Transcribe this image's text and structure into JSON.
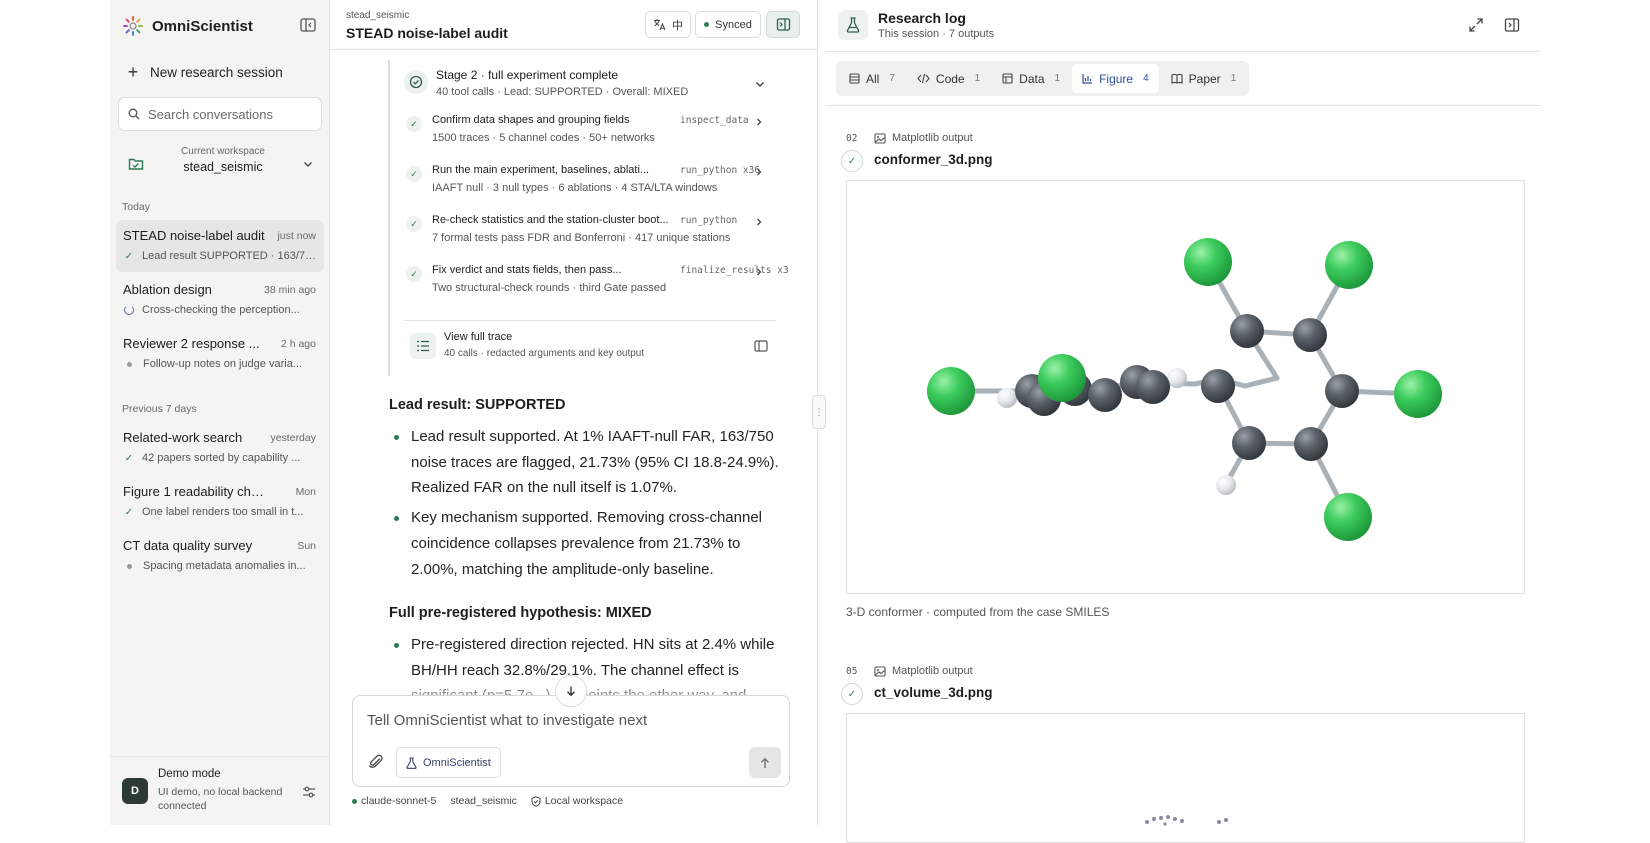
{
  "sidebar": {
    "brand": "OmniScientist",
    "new_session": "New research session",
    "search_placeholder": "Search conversations",
    "workspace": {
      "label": "Current workspace",
      "name": "stead_seismic"
    },
    "groups": [
      {
        "label": "Today",
        "items": [
          {
            "title": "STEAD noise-label audit",
            "time": "just now",
            "sub": "Lead result SUPPORTED · 163/750",
            "status": "done",
            "active": true
          },
          {
            "title": "Ablation design",
            "time": "38 min ago",
            "sub": "Cross-checking the perception...",
            "status": "running"
          },
          {
            "title": "Reviewer 2 response ...",
            "time": "2 h ago",
            "sub": "Follow-up notes on judge varia...",
            "status": "idle"
          }
        ]
      },
      {
        "label": "Previous 7 days",
        "items": [
          {
            "title": "Related-work search",
            "time": "yesterday",
            "sub": "42 papers sorted by capability ...",
            "status": "done"
          },
          {
            "title": "Figure 1 readability check",
            "time": "Mon",
            "sub": "One label renders too small in t...",
            "status": "done"
          },
          {
            "title": "CT data quality survey",
            "time": "Sun",
            "sub": "Spacing metadata anomalies in...",
            "status": "idle"
          }
        ]
      }
    ],
    "demo": {
      "avatar": "D",
      "title": "Demo mode",
      "desc": "UI demo, no local backend connected"
    }
  },
  "chat": {
    "crumb": "stead_seismic",
    "title": "STEAD noise-label audit",
    "lang_label": "中",
    "sync_label": "Synced",
    "stage": {
      "title": "Stage 2 · full experiment complete",
      "sub": "40 tool calls · Lead: SUPPORTED · Overall: MIXED",
      "steps": [
        {
          "title": "Confirm data shapes and grouping fields",
          "tool": "inspect_data",
          "sub": "1500 traces · 5 channel codes · 50+ networks"
        },
        {
          "title": "Run the main experiment, baselines, ablati...",
          "tool": "run_python x36",
          "sub": "IAAFT null · 3 null types · 6 ablations · 4 STA/LTA windows"
        },
        {
          "title": "Re-check statistics and the station-cluster boot...",
          "tool": "run_python",
          "sub": "7 formal tests pass FDR and Bonferroni · 417 unique stations"
        },
        {
          "title": "Fix verdict and stats fields, then pass...",
          "tool": "finalize_results x3",
          "sub": "Two structural-check rounds · third Gate passed"
        }
      ],
      "trace": {
        "title": "View full trace",
        "sub": "40 calls · redacted arguments and key output"
      }
    },
    "lead_heading": "Lead result: SUPPORTED",
    "lead_bullets": [
      "Lead result supported. At 1% IAAFT-null FAR, 163/750 noise traces are flagged, 21.73% (95% CI 18.8-24.9%). Realized FAR on the null itself is 1.07%.",
      "Key mechanism supported. Removing cross-channel coincidence collapses prevalence from 21.73% to 2.00%, matching the amplitude-only baseline."
    ],
    "full_heading": "Full pre-registered hypothesis: MIXED",
    "full_bullets": [
      "Pre-registered direction rejected. HN sits at 2.4% while BH/HH reach 32.8%/29.1%. The channel effect is significant (p=5.7e...) but points the other way, and"
    ],
    "composer_placeholder": "Tell OmniScientist what to investigate next",
    "agent_chip": "OmniScientist",
    "footer": {
      "model": "claude-sonnet-5",
      "workspace": "stead_seismic",
      "mode": "Local workspace"
    }
  },
  "log": {
    "title": "Research log",
    "sub": "This session · 7 outputs",
    "tabs": [
      {
        "label": "All",
        "count": "7",
        "icon": "list-icon"
      },
      {
        "label": "Code",
        "count": "1",
        "icon": "code-icon"
      },
      {
        "label": "Data",
        "count": "1",
        "icon": "table-icon"
      },
      {
        "label": "Figure",
        "count": "4",
        "icon": "bar-chart-icon",
        "active": true
      },
      {
        "label": "Paper",
        "count": "1",
        "icon": "book-icon"
      }
    ],
    "outputs": [
      {
        "index": "02",
        "kind": "Matplotlib output",
        "name": "conformer_3d.png",
        "caption": "3-D conformer · computed from the case SMILES"
      },
      {
        "index": "05",
        "kind": "Matplotlib output",
        "name": "ct_volume_3d.png",
        "caption": ""
      }
    ]
  },
  "colors": {
    "accent": "#2f7a57",
    "tab_active": "#2f4ea0",
    "chlorine": "#39c45a",
    "carbon": "#5a5f66",
    "hydrogen": "#dfe3e6",
    "bond": "#aab0b6"
  }
}
